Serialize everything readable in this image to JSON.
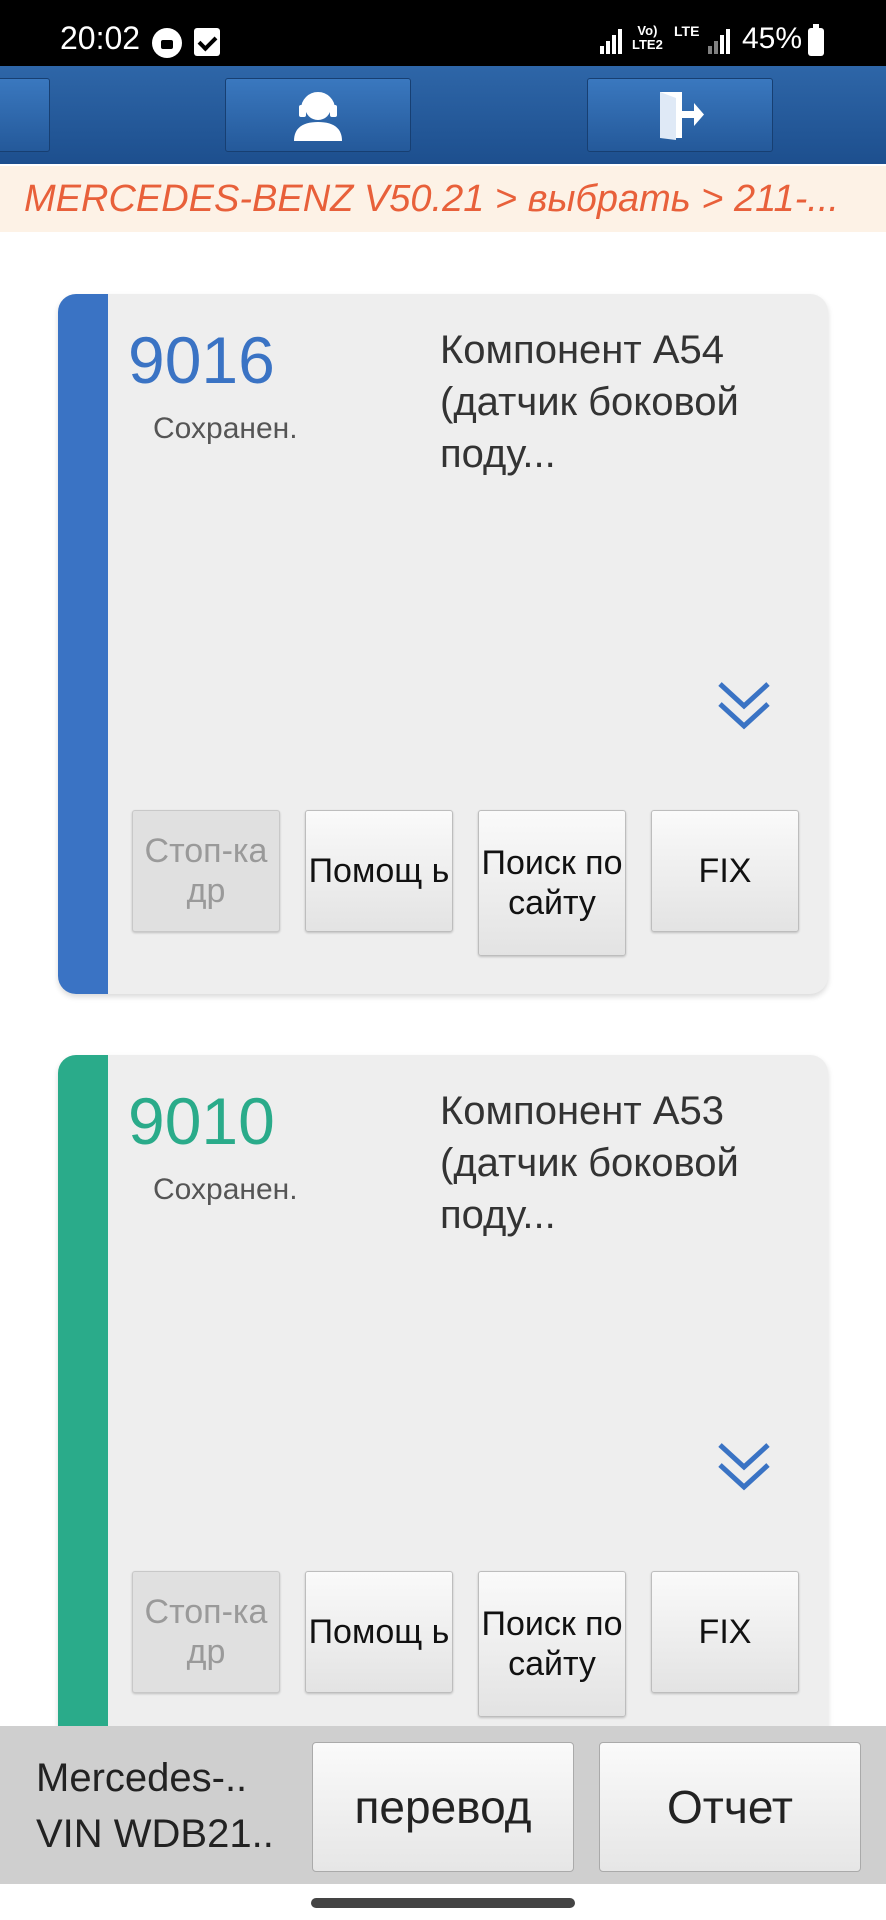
{
  "status_bar": {
    "time": "20:02",
    "volte": "Vo)\nLTE2",
    "lte": "LTE",
    "battery": "45%"
  },
  "toolbar": {
    "icons": [
      "menu-button",
      "support-agent-icon",
      "exit-icon"
    ]
  },
  "breadcrumb": "MERCEDES-BENZ V50.21 > выбрать > 211-...",
  "cards": [
    {
      "code": "9016",
      "status": "Сохранен.",
      "description": "Компонент A54 (датчик боковой поду...",
      "accent": "#3a73c4",
      "buttons": {
        "freeze_frame": "Стоп-ка др",
        "help": "Помощ ь",
        "search": "Поиск по сайту",
        "fix": "FIX"
      }
    },
    {
      "code": "9010",
      "status": "Сохранен.",
      "description": "Компонент A53 (датчик боковой поду...",
      "accent": "#2aab8a",
      "buttons": {
        "freeze_frame": "Стоп-ка др",
        "help": "Помощ ь",
        "search": "Поиск по сайту",
        "fix": "FIX"
      }
    }
  ],
  "bottom": {
    "vehicle_line1": "Mercedes-..",
    "vehicle_line2": "VIN WDB21..",
    "translate": "перевод",
    "report": "Отчет"
  }
}
